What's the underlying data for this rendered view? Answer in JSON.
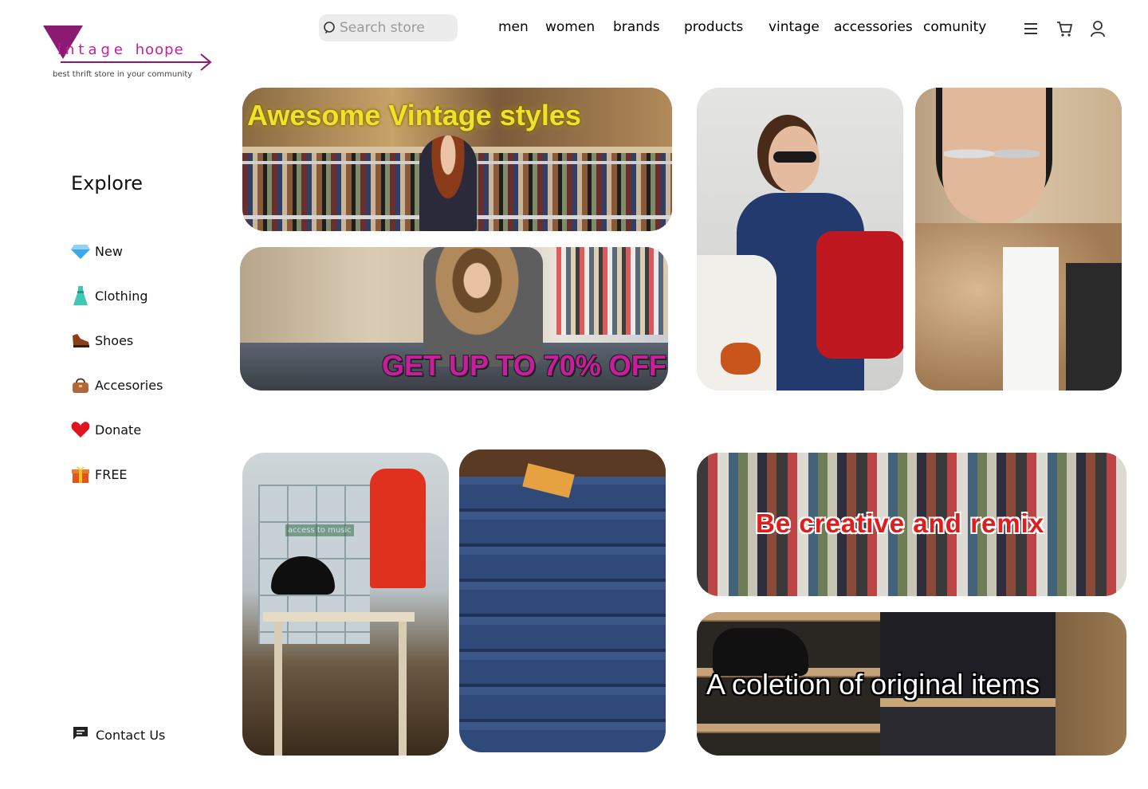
{
  "brand": {
    "name_part1": "intage",
    "name_part2": "hoope",
    "tagline": "best thrift store in your community",
    "accent_color": "#c01fa0"
  },
  "search": {
    "placeholder": "Search store",
    "icon": "search-icon"
  },
  "nav": {
    "items": [
      {
        "label": "men"
      },
      {
        "label": "women"
      },
      {
        "label": "brands"
      },
      {
        "label": "products"
      },
      {
        "label": "vintage"
      },
      {
        "label": "accessories"
      },
      {
        "label": "comunity"
      }
    ],
    "icons": [
      "menu-icon",
      "cart-icon",
      "user-icon"
    ]
  },
  "sidebar": {
    "title": "Explore",
    "items": [
      {
        "label": "New",
        "icon": "gem-icon"
      },
      {
        "label": "Clothing",
        "icon": "dress-icon"
      },
      {
        "label": "Shoes",
        "icon": "shoe-icon"
      },
      {
        "label": "Accesories",
        "icon": "handbag-icon"
      },
      {
        "label": "Donate",
        "icon": "heart-icon"
      },
      {
        "label": "FREE",
        "icon": "gift-icon"
      }
    ],
    "contact": {
      "label": "Contact Us",
      "icon": "chat-icon"
    }
  },
  "tiles": {
    "banner1": "Awesome Vintage styles",
    "banner2": "GET UP TO 70% OFF",
    "banner3": "Be creative and remix",
    "banner4": "A coletion of original items",
    "window_sign": "access to music"
  }
}
